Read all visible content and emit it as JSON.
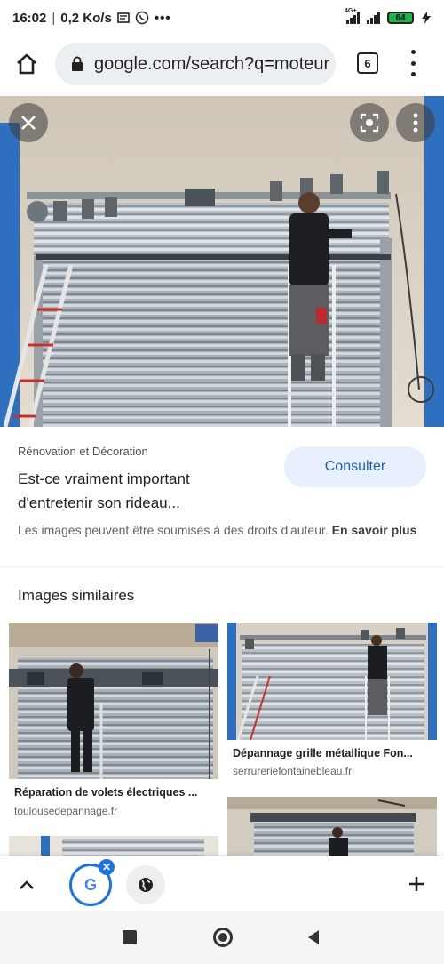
{
  "status_bar": {
    "time": "16:02",
    "speed": "0,2 Ko/s",
    "network": "4G+",
    "battery": "64"
  },
  "browser": {
    "url": "google.com/search?q=moteur",
    "tab_count": "6"
  },
  "result": {
    "source": "Rénovation et Décoration",
    "title": "Est-ce vraiment important d'entretenir son rideau...",
    "consult_label": "Consulter",
    "copyright_text": "Les images peuvent être soumises à des droits d'auteur.",
    "learn_more_label": "En savoir plus"
  },
  "similar": {
    "heading": "Images similaires",
    "items": [
      {
        "title": "Réparation de volets électriques ...",
        "domain": "toulousedepannage.fr"
      },
      {
        "title": "Dépannage grille métallique Fon...",
        "domain": "serrureriefontainebleau.fr"
      }
    ]
  },
  "icons": {
    "close": "close-icon",
    "lens": "lens-icon",
    "more": "more-vert-icon",
    "home": "home-icon",
    "lock": "lock-icon"
  },
  "colors": {
    "accent": "#1a73e8",
    "consult_bg": "#e8f0fe",
    "battery": "#1fb24a"
  }
}
